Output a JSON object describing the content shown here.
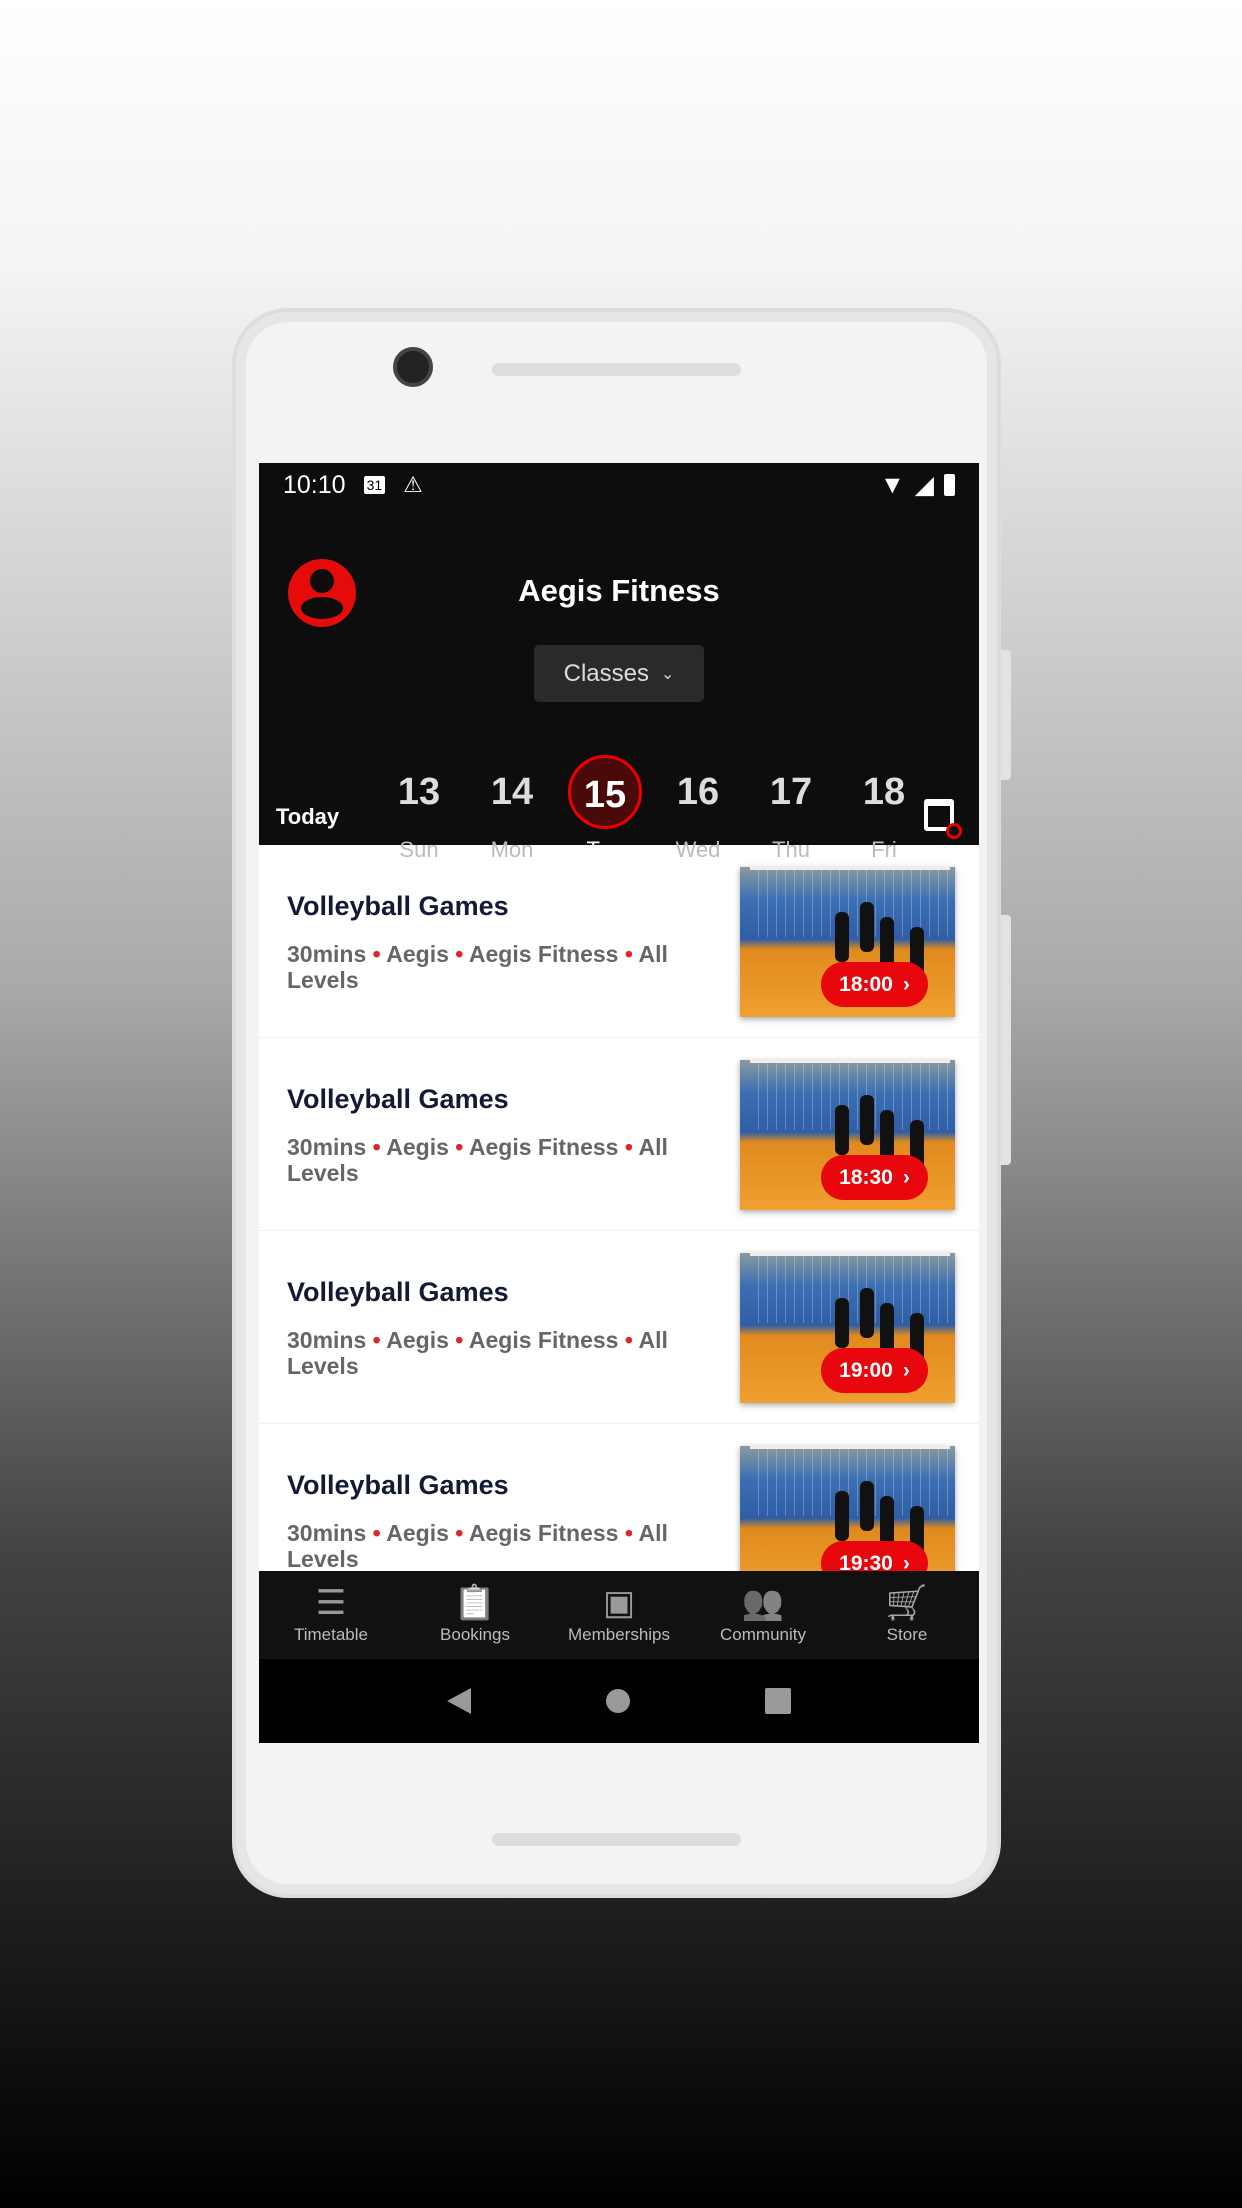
{
  "status": {
    "time": "10:10",
    "calendar_day": "31"
  },
  "header": {
    "title": "Aegis Fitness",
    "dropdown": "Classes",
    "today_label": "Today"
  },
  "dates": [
    {
      "num": "13",
      "day": "Sun"
    },
    {
      "num": "14",
      "day": "Mon"
    },
    {
      "num": "15",
      "day": "Tue",
      "selected": true
    },
    {
      "num": "16",
      "day": "Wed"
    },
    {
      "num": "17",
      "day": "Thu"
    },
    {
      "num": "18",
      "day": "Fri"
    }
  ],
  "classes": [
    {
      "title": "Volleyball Games",
      "duration": "30mins",
      "instructor": "Aegis",
      "location": "Aegis Fitness",
      "level": "All Levels",
      "time": "18:00"
    },
    {
      "title": "Volleyball Games",
      "duration": "30mins",
      "instructor": "Aegis",
      "location": "Aegis Fitness",
      "level": "All Levels",
      "time": "18:30"
    },
    {
      "title": "Volleyball Games",
      "duration": "30mins",
      "instructor": "Aegis",
      "location": "Aegis Fitness",
      "level": "All Levels",
      "time": "19:00"
    },
    {
      "title": "Volleyball Games",
      "duration": "30mins",
      "instructor": "Aegis",
      "location": "Aegis Fitness",
      "level": "All Levels",
      "time": "19:30"
    }
  ],
  "bottom_nav": [
    {
      "label": "Timetable",
      "icon": "list-star-icon"
    },
    {
      "label": "Bookings",
      "icon": "clipboard-check-icon"
    },
    {
      "label": "Memberships",
      "icon": "membership-card-icon"
    },
    {
      "label": "Community",
      "icon": "users-icon"
    },
    {
      "label": "Store",
      "icon": "cart-icon"
    }
  ],
  "colors": {
    "accent": "#e8070c",
    "header_bg": "#0d0d0d",
    "title_text": "#141a33"
  }
}
